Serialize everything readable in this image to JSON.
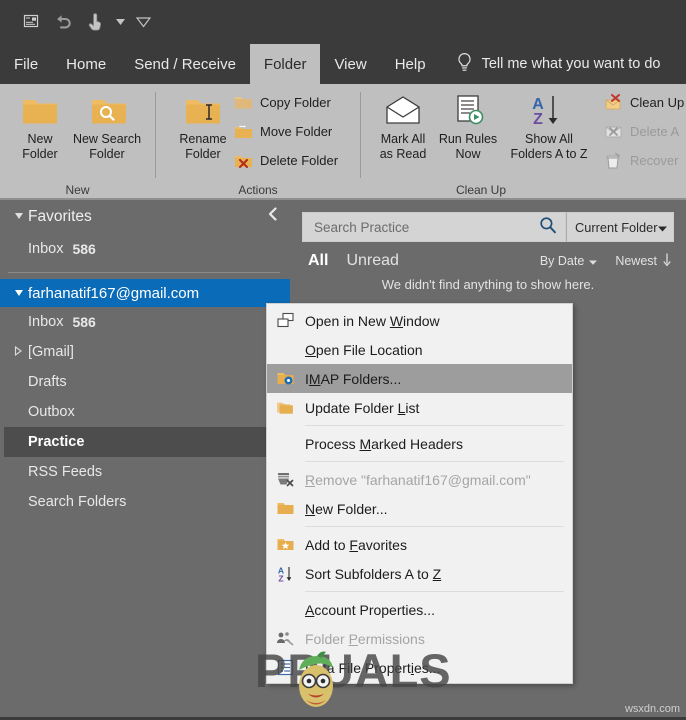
{
  "quick_access": {
    "items": [
      {
        "name": "customize-quick-access-icon",
        "label": "Quick Access"
      },
      {
        "name": "undo-icon",
        "label": "Undo"
      },
      {
        "name": "touch-mode-icon",
        "label": "Touch/Mouse Mode"
      },
      {
        "name": "dropdown-caret-icon",
        "label": "More"
      },
      {
        "name": "ribbon-display-options-icon",
        "label": "Ribbon Display Options"
      }
    ]
  },
  "tabs": [
    {
      "label": "File",
      "active": false
    },
    {
      "label": "Home",
      "active": false
    },
    {
      "label": "Send / Receive",
      "active": false
    },
    {
      "label": "Folder",
      "active": true
    },
    {
      "label": "View",
      "active": false
    },
    {
      "label": "Help",
      "active": false
    }
  ],
  "tell_me": {
    "label": "Tell me what you want to do",
    "icon": "lightbulb-icon"
  },
  "ribbon": {
    "groups": [
      {
        "title": "New",
        "big_buttons": [
          {
            "line1": "New",
            "line2": "Folder",
            "icon": "new-folder-icon"
          },
          {
            "line1": "New Search",
            "line2": "Folder",
            "icon": "new-search-folder-icon"
          }
        ]
      },
      {
        "title": "Actions",
        "big_buttons": [
          {
            "line1": "Rename",
            "line2": "Folder",
            "icon": "rename-folder-icon"
          }
        ],
        "small_buttons": [
          {
            "label": "Copy Folder",
            "icon": "copy-folder-icon",
            "disabled": false
          },
          {
            "label": "Move Folder",
            "icon": "move-folder-icon",
            "disabled": false
          },
          {
            "label": "Delete Folder",
            "icon": "delete-folder-icon",
            "disabled": false
          }
        ]
      },
      {
        "title": "Clean Up",
        "big_buttons": [
          {
            "line1": "Mark All",
            "line2": "as Read",
            "icon": "mark-all-read-icon"
          },
          {
            "line1": "Run Rules",
            "line2": "Now",
            "icon": "run-rules-now-icon"
          },
          {
            "line1": "Show All",
            "line2": "Folders A to Z",
            "icon": "sort-az-icon"
          }
        ],
        "small_buttons": [
          {
            "label": "Clean Up",
            "icon": "clean-up-icon",
            "disabled": false
          },
          {
            "label": "Delete A",
            "icon": "delete-all-icon",
            "disabled": true
          },
          {
            "label": "Recover",
            "icon": "recover-deleted-icon",
            "disabled": true
          }
        ]
      }
    ]
  },
  "sidebar": {
    "favorites": {
      "label": "Favorites",
      "expand_icon": "triangle-down-icon",
      "collapse_icon": "chevron-left-icon",
      "items": [
        {
          "label": "Inbox",
          "count": "586"
        }
      ]
    },
    "account": {
      "label": "farhanatif167@gmail.com",
      "expand_icon": "triangle-down-icon",
      "selected": true
    },
    "folders": [
      {
        "label": "Inbox",
        "count": "586",
        "selected": false,
        "expandable": false
      },
      {
        "label": "[Gmail]",
        "count": "",
        "selected": false,
        "expandable": true
      },
      {
        "label": "Drafts",
        "count": "",
        "selected": false,
        "expandable": false
      },
      {
        "label": "Outbox",
        "count": "",
        "selected": false,
        "expandable": false
      },
      {
        "label": "Practice",
        "count": "",
        "selected": true,
        "expandable": false
      },
      {
        "label": "RSS Feeds",
        "count": "",
        "selected": false,
        "expandable": false
      },
      {
        "label": "Search Folders",
        "count": "",
        "selected": false,
        "expandable": false
      }
    ]
  },
  "content": {
    "search": {
      "placeholder": "Search Practice",
      "value": "",
      "icon": "search-icon"
    },
    "scope": {
      "label": "Current Folder",
      "caret_icon": "chevron-down-icon"
    },
    "filters": {
      "all": "All",
      "unread": "Unread",
      "sort_by": "By Date",
      "sort_order": "Newest",
      "sort_caret_icon": "chevron-down-icon",
      "sort_arrow_icon": "arrow-down-icon"
    },
    "empty_message": "We didn't find anything to show here."
  },
  "context_menu": {
    "items": [
      {
        "label": "Open in New Window",
        "icon": "open-new-window-icon",
        "disabled": false,
        "highlighted": false,
        "sep_after": false,
        "accel": "W"
      },
      {
        "label": "Open File Location",
        "icon": "",
        "disabled": false,
        "highlighted": false,
        "sep_after": false,
        "accel": "O"
      },
      {
        "label": "IMAP Folders...",
        "icon": "imap-folders-icon",
        "disabled": false,
        "highlighted": true,
        "sep_after": false,
        "accel": "M"
      },
      {
        "label": "Update Folder List",
        "icon": "update-folder-list-icon",
        "disabled": false,
        "highlighted": false,
        "sep_after": true,
        "accel": "L"
      },
      {
        "label": "Process Marked Headers",
        "icon": "",
        "disabled": false,
        "highlighted": false,
        "sep_after": true,
        "accel": "M"
      },
      {
        "label": "Remove \"farhanatif167@gmail.com\"",
        "icon": "remove-account-icon",
        "disabled": true,
        "highlighted": false,
        "sep_after": false,
        "accel": "R"
      },
      {
        "label": "New Folder...",
        "icon": "new-folder-small-icon",
        "disabled": false,
        "highlighted": false,
        "sep_after": true,
        "accel": "N"
      },
      {
        "label": "Add to Favorites",
        "icon": "add-favorites-icon",
        "disabled": false,
        "highlighted": false,
        "sep_after": false,
        "accel": "F"
      },
      {
        "label": "Sort Subfolders A to Z",
        "icon": "sort-az-small-icon",
        "disabled": false,
        "highlighted": false,
        "sep_after": true,
        "accel": "Z"
      },
      {
        "label": "Account Properties...",
        "icon": "",
        "disabled": false,
        "highlighted": false,
        "sep_after": false,
        "accel": "A"
      },
      {
        "label": "Folder Permissions",
        "icon": "folder-permissions-icon",
        "disabled": true,
        "highlighted": false,
        "sep_after": false,
        "accel": "P"
      },
      {
        "label": "Data File Properties...",
        "icon": "data-file-properties-icon",
        "disabled": false,
        "highlighted": false,
        "sep_after": false,
        "accel": "i"
      }
    ]
  },
  "watermark": {
    "brand": "PPUALS",
    "site": "wsxdn.com"
  },
  "colors": {
    "titlebar": "#3b3b3b",
    "ribbon": "#bfbfbf",
    "app_bg": "#6b6b6b",
    "accent_blue": "#0a6cb8",
    "menu_bg": "#f1f1f1",
    "menu_highlight": "#9d9d9d",
    "folder_gold": "#eab559"
  }
}
